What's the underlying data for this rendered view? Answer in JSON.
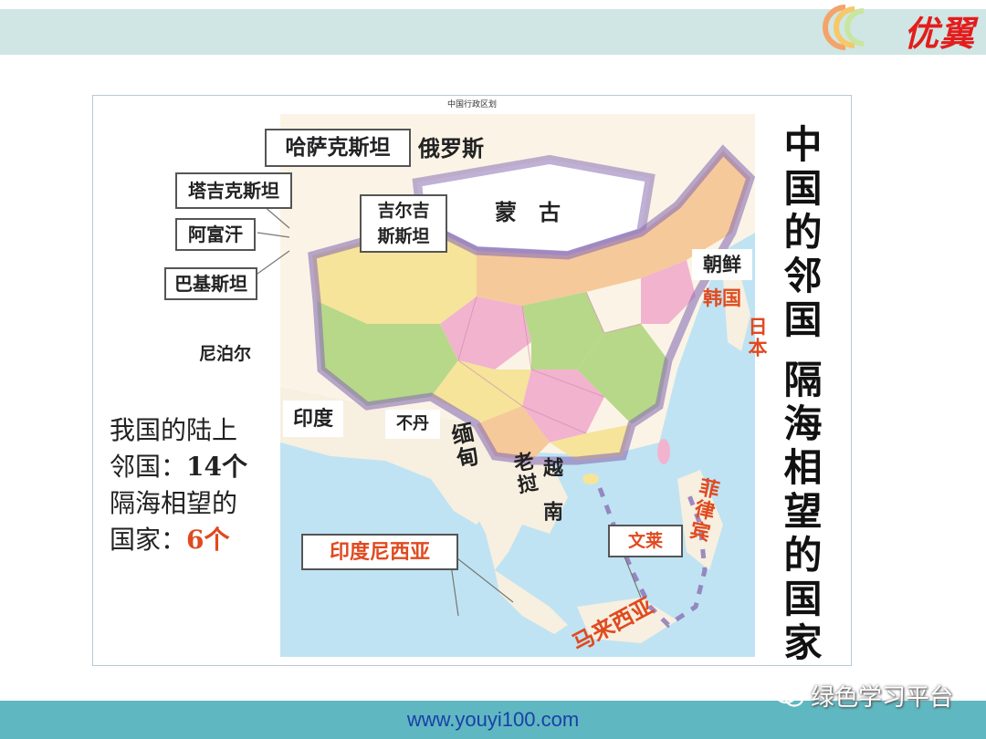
{
  "header": {
    "logo_text": "优翼",
    "logo_colors": [
      "#f4a36b",
      "#f6c86a",
      "#c8e6a0",
      "#e31d1d"
    ]
  },
  "map": {
    "title": "中国行政区划",
    "labels": {
      "kazakhstan": "哈萨克斯坦",
      "russia": "俄罗斯",
      "mongolia": "蒙　古",
      "tajikistan": "塔吉克斯坦",
      "afghanistan": "阿富汗",
      "kyrgyzstan_line1": "吉尔吉",
      "kyrgyzstan_line2": "斯斯坦",
      "pakistan": "巴基斯坦",
      "nepal": "尼泊尔",
      "india": "印度",
      "bhutan": "不丹",
      "myanmar": "缅甸",
      "laos": "老挝",
      "vietnam": "越南",
      "north_korea": "朝鲜",
      "south_korea": "韩国",
      "japan": "日本",
      "philippines": "菲律宾",
      "brunei": "文莱",
      "malaysia": "马来西亚",
      "indonesia": "印度尼西亚"
    },
    "colors": {
      "sea": "#bfe3f2",
      "china_green": "#b7d889",
      "china_pink": "#f2b3cf",
      "china_yellow": "#f5e49a",
      "china_orange": "#f6c99a",
      "border_purple": "#8a6fb5",
      "neighbor_red": "#e04a1f"
    }
  },
  "side_title": {
    "line1": "中国的邻国",
    "line2": "隔海相望的国家"
  },
  "summary": {
    "line1": "我国的陆上",
    "line2_prefix": "邻国：",
    "land_count": "14个",
    "line3": "隔海相望的",
    "line4_prefix": "国家：",
    "sea_count": "6个"
  },
  "footer": {
    "url": "www.youyi100.com",
    "wechat": "绿色学习平台",
    "wechat_icon": "wechat-icon"
  }
}
